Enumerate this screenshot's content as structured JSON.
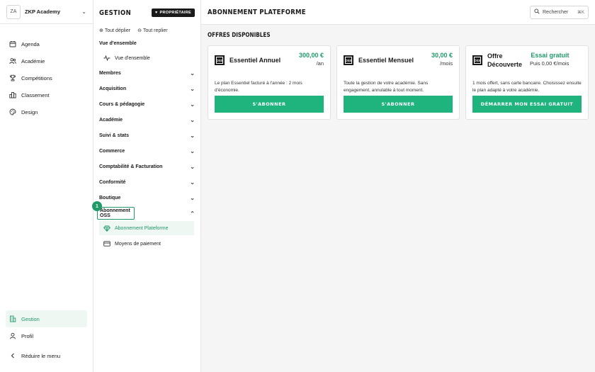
{
  "brand": {
    "initials": "ZA",
    "name": "ZKP Academy"
  },
  "main_nav": [
    {
      "label": "Agenda",
      "icon": "calendar-icon"
    },
    {
      "label": "Académie",
      "icon": "users-icon"
    },
    {
      "label": "Compétitions",
      "icon": "trophy-icon"
    },
    {
      "label": "Classement",
      "icon": "podium-icon"
    },
    {
      "label": "Design",
      "icon": "palette-icon"
    }
  ],
  "bottom_nav": [
    {
      "label": "Gestion",
      "icon": "building-icon",
      "active": true
    },
    {
      "label": "Profil",
      "icon": "user-icon"
    },
    {
      "label": "Réduire le menu",
      "icon": "chevron-left-icon"
    }
  ],
  "sidebar2": {
    "title": "GESTION",
    "owner_badge": "PROPRIÉTAIRE",
    "expand_all": "Tout déplier",
    "collapse_all": "Tout replier",
    "groups": [
      "Vue d'ensemble",
      "Membres",
      "Acquisition",
      "Cours & pédagogie",
      "Académie",
      "Suivi & stats",
      "Commerce",
      "Comptabilité & Facturation",
      "Conformité",
      "Boutique",
      "Abonnement OSS"
    ],
    "overview_item": "Vue d'ensemble",
    "oss_items": [
      "Abonnement Plateforme",
      "Moyens de paiement"
    ],
    "step_badge": "1"
  },
  "header": {
    "title": "ABONNEMENT PLATEFORME",
    "search_label": "Rechercher",
    "search_shortcut": "⌘K"
  },
  "section_title": "OFFRES DISPONIBLES",
  "plans": [
    {
      "logo": "OSS",
      "name": "Essentiel Annuel",
      "price": "300,00 €",
      "period": "/an",
      "description": "Le plan Essentiel facturé à l'année : 2 mois d'économie.",
      "cta": "S'ABONNER"
    },
    {
      "logo": "OSS",
      "name": "Essentiel Mensuel",
      "price": "30,00 €",
      "period": "/mois",
      "description": "Toute la gestion de votre académie. Sans engagement, annulable à tout moment.",
      "cta": "S'ABONNER"
    },
    {
      "logo": "OSS",
      "name": "Offre Découverte",
      "price": "Essai gratuit",
      "period": "Puis 0,00 €/mois",
      "description": "1 mois offert, sans carte bancaire. Choisissez ensuite le plan adapté à votre académie.",
      "cta": "DÉMARRER MON ESSAI GRATUIT"
    }
  ],
  "colors": {
    "accent": "#1f9a68",
    "button": "#1fb47e"
  }
}
